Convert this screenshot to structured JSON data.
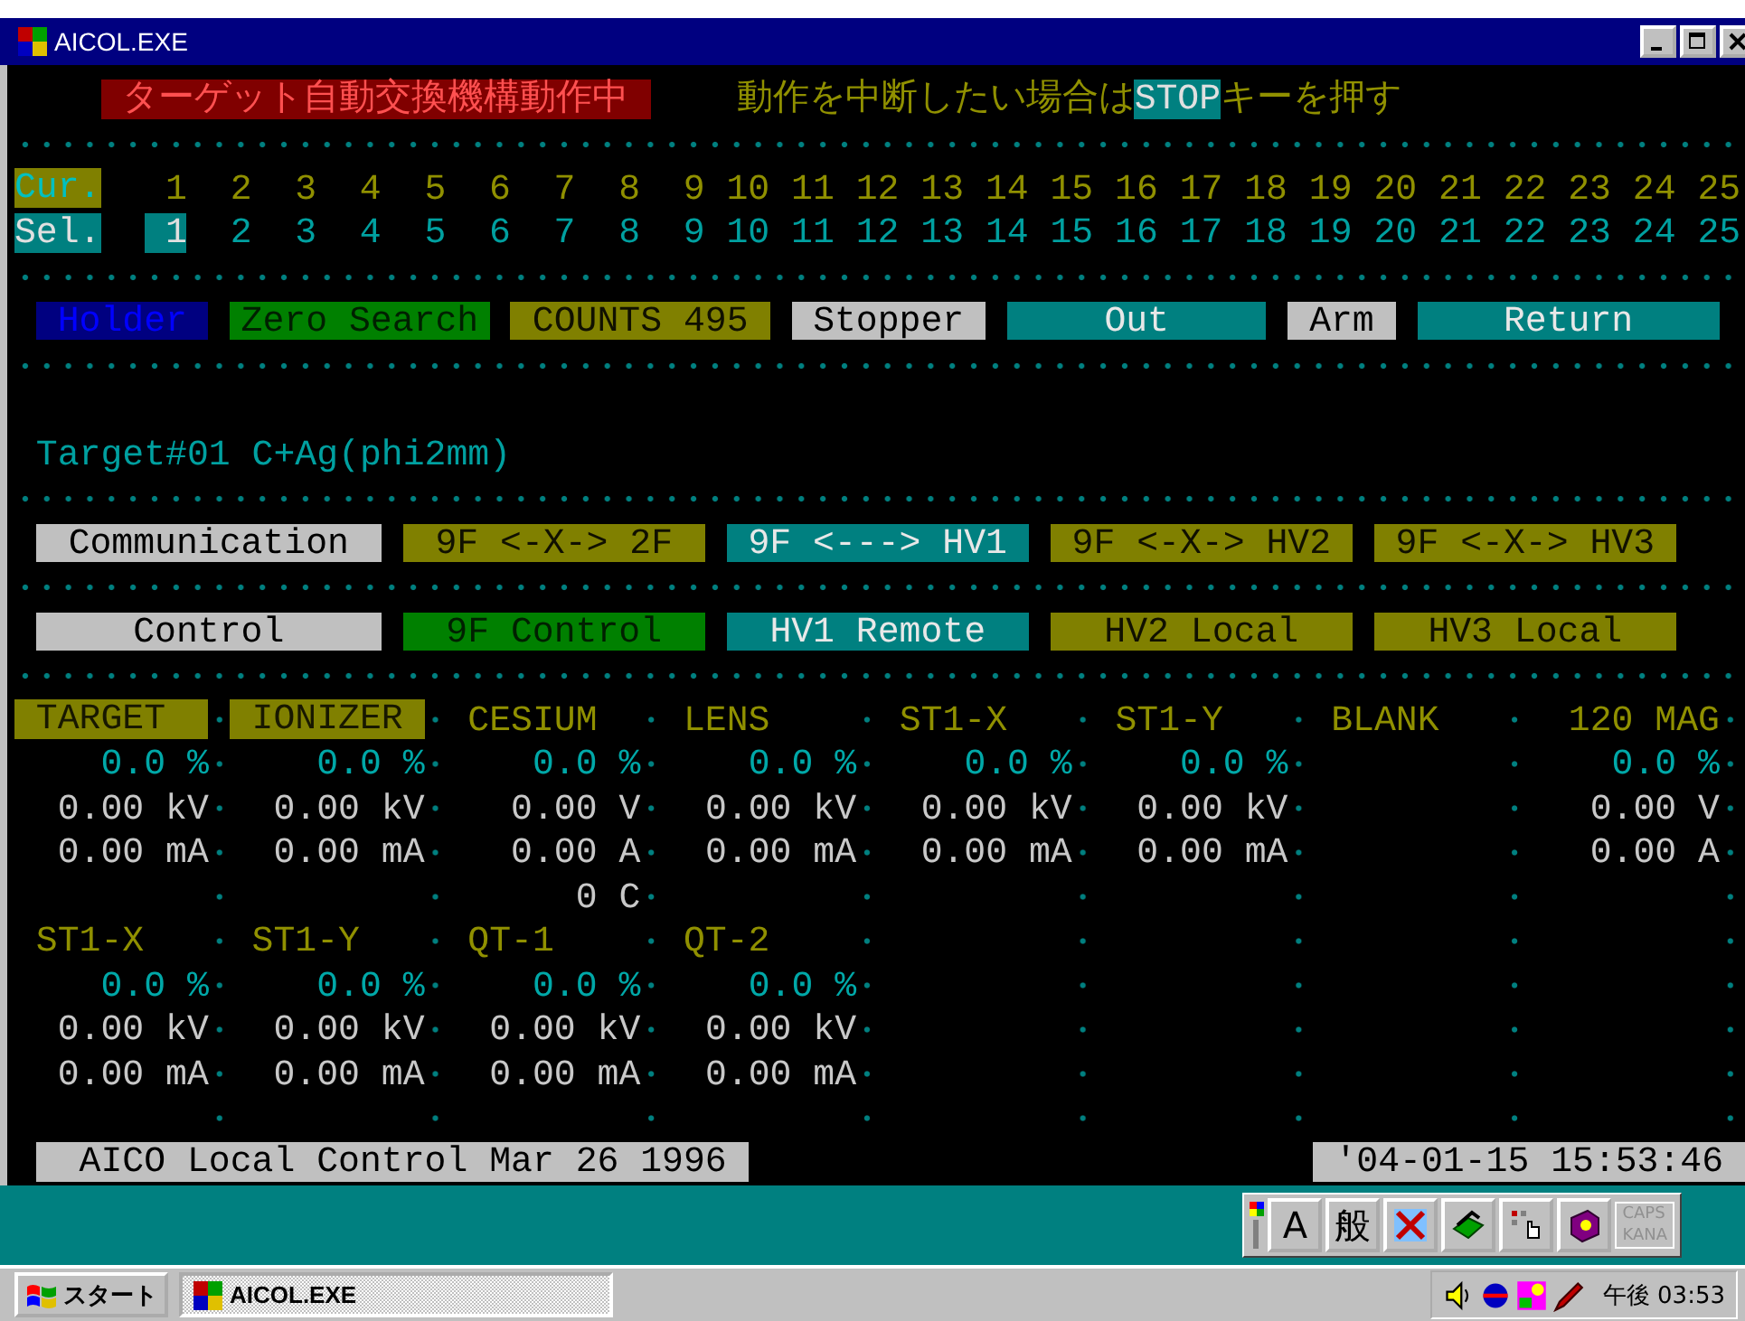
{
  "window": {
    "title": "AICOL.EXE"
  },
  "header": {
    "status": "ターゲット自動交換機構動作中",
    "message_before": "動作を中断したい場合は",
    "key": "STOP",
    "message_after": "キーを押す"
  },
  "positions": {
    "cur_label": "Cur.",
    "sel_label": "Sel.",
    "current": [
      "1",
      "2",
      "3",
      "4",
      "5",
      "6",
      "7",
      "8",
      "9",
      "10",
      "11",
      "12",
      "13",
      "14",
      "15",
      "16",
      "17",
      "18",
      "19",
      "20",
      "21",
      "22",
      "23",
      "24",
      "25"
    ],
    "selection": [
      {
        "label": "1",
        "selected": true
      },
      {
        "label": "2",
        "selected": false
      },
      {
        "label": "3",
        "selected": false
      },
      {
        "label": "4",
        "selected": false
      },
      {
        "label": "5",
        "selected": false
      },
      {
        "label": "6",
        "selected": false
      },
      {
        "label": "7",
        "selected": false
      },
      {
        "label": "8",
        "selected": false
      },
      {
        "label": "9",
        "selected": false
      },
      {
        "label": "10",
        "selected": false
      },
      {
        "label": "11",
        "selected": false
      },
      {
        "label": "12",
        "selected": false
      },
      {
        "label": "13",
        "selected": false
      },
      {
        "label": "14",
        "selected": false
      },
      {
        "label": "15",
        "selected": false
      },
      {
        "label": "16",
        "selected": false
      },
      {
        "label": "17",
        "selected": false
      },
      {
        "label": "18",
        "selected": false
      },
      {
        "label": "19",
        "selected": false
      },
      {
        "label": "20",
        "selected": false
      },
      {
        "label": "21",
        "selected": false
      },
      {
        "label": "22",
        "selected": false
      },
      {
        "label": "23",
        "selected": false
      },
      {
        "label": "24",
        "selected": false
      },
      {
        "label": "25",
        "selected": false
      }
    ]
  },
  "mechanism": [
    {
      "label": "Holder",
      "color": "#000080"
    },
    {
      "label": "Zero Search",
      "color": "#008000"
    },
    {
      "label": "COUNTS 495",
      "color": "#808000"
    },
    {
      "label": "Stopper",
      "color": "#c0c0c0"
    },
    {
      "label": "Out",
      "color": "#008080"
    },
    {
      "label": "Arm",
      "color": "#c0c0c0"
    },
    {
      "label": "Return",
      "color": "#008080"
    }
  ],
  "target": "Target#01 C+Ag(phi2mm)",
  "communication": {
    "label": "Communication",
    "links": [
      {
        "label": "9F <-X-> 2F",
        "color": "#808000"
      },
      {
        "label": "9F <---> HV1",
        "color": "#008080"
      },
      {
        "label": "9F <-X-> HV2",
        "color": "#808000"
      },
      {
        "label": "9F <-X-> HV3",
        "color": "#808000"
      }
    ]
  },
  "control": {
    "label": "Control",
    "modes": [
      {
        "label": "9F Control",
        "color": "#008000"
      },
      {
        "label": "HV1 Remote",
        "color": "#008080"
      },
      {
        "label": "HV2 Local",
        "color": "#808000"
      },
      {
        "label": "HV3 Local",
        "color": "#808000"
      }
    ]
  },
  "monitors": [
    [
      {
        "name": "TARGET",
        "highlighted": true,
        "lines": [
          {
            "kind": "percent",
            "text": "0.0 %"
          },
          {
            "kind": "voltage",
            "text": "0.00 kV"
          },
          {
            "kind": "current",
            "text": "0.00 mA"
          }
        ]
      },
      {
        "name": "IONIZER",
        "highlighted": true,
        "lines": [
          {
            "kind": "percent",
            "text": "0.0 %"
          },
          {
            "kind": "voltage",
            "text": "0.00 kV"
          },
          {
            "kind": "current",
            "text": "0.00 mA"
          }
        ]
      },
      {
        "name": "CESIUM",
        "highlighted": false,
        "lines": [
          {
            "kind": "percent",
            "text": "0.0 %"
          },
          {
            "kind": "voltage",
            "text": "0.00 V"
          },
          {
            "kind": "current",
            "text": "0.00 A"
          },
          {
            "kind": "temperature",
            "text": "0 C"
          }
        ]
      },
      {
        "name": "LENS",
        "highlighted": false,
        "lines": [
          {
            "kind": "percent",
            "text": "0.0 %"
          },
          {
            "kind": "voltage",
            "text": "0.00 kV"
          },
          {
            "kind": "current",
            "text": "0.00 mA"
          }
        ]
      },
      {
        "name": "ST1-X",
        "highlighted": false,
        "lines": [
          {
            "kind": "percent",
            "text": "0.0 %"
          },
          {
            "kind": "voltage",
            "text": "0.00 kV"
          },
          {
            "kind": "current",
            "text": "0.00 mA"
          }
        ]
      },
      {
        "name": "ST1-Y",
        "highlighted": false,
        "lines": [
          {
            "kind": "percent",
            "text": "0.0 %"
          },
          {
            "kind": "voltage",
            "text": "0.00 kV"
          },
          {
            "kind": "current",
            "text": "0.00 mA"
          }
        ]
      },
      {
        "name": "BLANK",
        "highlighted": false
      },
      {
        "name": "120 MAG",
        "highlighted": false,
        "lines": [
          {
            "kind": "percent",
            "text": "0.0 %"
          },
          {
            "kind": "voltage",
            "text": "0.00 V"
          },
          {
            "kind": "current",
            "text": "0.00 A"
          }
        ]
      }
    ],
    [
      {
        "name": "ST1-X",
        "highlighted": false,
        "lines": [
          {
            "kind": "percent",
            "text": "0.0 %"
          },
          {
            "kind": "voltage",
            "text": "0.00 kV"
          },
          {
            "kind": "current",
            "text": "0.00 mA"
          }
        ]
      },
      {
        "name": "ST1-Y",
        "highlighted": false,
        "lines": [
          {
            "kind": "percent",
            "text": "0.0 %"
          },
          {
            "kind": "voltage",
            "text": "0.00 kV"
          },
          {
            "kind": "current",
            "text": "0.00 mA"
          }
        ]
      },
      {
        "name": "QT-1",
        "highlighted": false,
        "lines": [
          {
            "kind": "percent",
            "text": "0.0 %"
          },
          {
            "kind": "voltage",
            "text": "0.00 kV"
          },
          {
            "kind": "current",
            "text": "0.00 mA"
          }
        ]
      },
      {
        "name": "QT-2",
        "highlighted": false,
        "lines": [
          {
            "kind": "percent",
            "text": "0.0 %"
          },
          {
            "kind": "voltage",
            "text": "0.00 kV"
          },
          {
            "kind": "current",
            "text": "0.00 mA"
          }
        ]
      }
    ]
  ],
  "footer": {
    "version": "AICO Local Control Mar 26 1996",
    "timestamp": "'04-01-15 15:53:46"
  },
  "ime_bar": {
    "mode": "A",
    "input": "般",
    "indicators": [
      {
        "label": "CAPS",
        "on": false
      },
      {
        "label": "KANA",
        "on": false
      }
    ]
  },
  "taskbar": {
    "start": "スタート",
    "tasks": [
      {
        "label": "AICOL.EXE",
        "selected": true
      }
    ],
    "clock": "午後 03:53"
  }
}
